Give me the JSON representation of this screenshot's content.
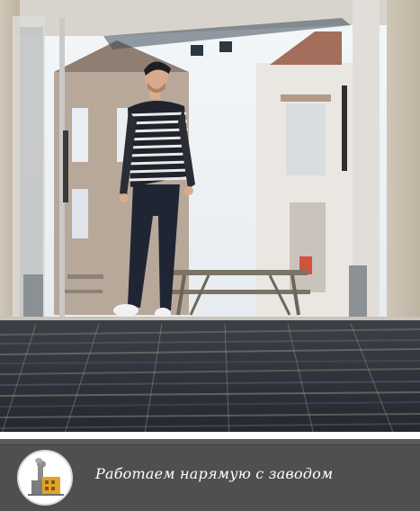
{
  "banner": {
    "text": "Работаем нарямую с заводом",
    "icon": "factory-icon"
  },
  "colors": {
    "banner_bg": "#4f4f4f",
    "badge_accent": "#e0a42a",
    "carpet_dark": "#2a2d36",
    "carpet_stripe": "#6d6a66"
  }
}
